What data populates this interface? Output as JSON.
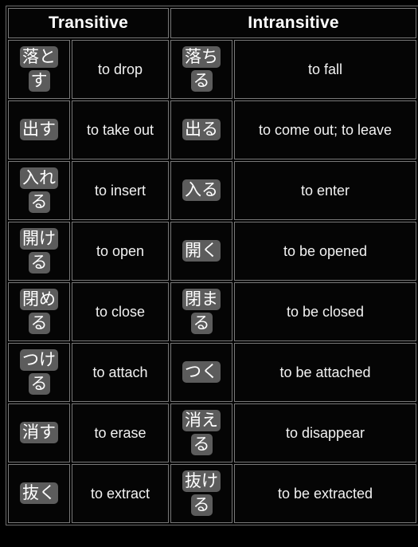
{
  "table": {
    "headers": [
      {
        "label": "Transitive",
        "span": 2
      },
      {
        "label": "Intransitive",
        "span": 2
      }
    ],
    "rows": [
      {
        "transitive_jp": "落とす",
        "transitive_en": "to drop",
        "intransitive_jp": "落ちる",
        "intransitive_en": "to fall"
      },
      {
        "transitive_jp": "出す",
        "transitive_en": "to take out",
        "intransitive_jp": "出る",
        "intransitive_en": "to come out; to leave"
      },
      {
        "transitive_jp": "入れる",
        "transitive_en": "to insert",
        "intransitive_jp": "入る",
        "intransitive_en": "to enter"
      },
      {
        "transitive_jp": "開ける",
        "transitive_en": "to open",
        "intransitive_jp": "開く",
        "intransitive_en": "to be opened"
      },
      {
        "transitive_jp": "閉める",
        "transitive_en": "to close",
        "intransitive_jp": "閉まる",
        "intransitive_en": "to be closed"
      },
      {
        "transitive_jp": "つける",
        "transitive_en": "to attach",
        "intransitive_jp": "つく",
        "intransitive_en": "to be attached"
      },
      {
        "transitive_jp": "消す",
        "transitive_en": "to erase",
        "intransitive_jp": "消える",
        "intransitive_en": "to disappear"
      },
      {
        "transitive_jp": "抜く",
        "transitive_en": "to extract",
        "intransitive_jp": "抜ける",
        "intransitive_en": "to be extracted"
      }
    ]
  },
  "colors": {
    "background": "#000000",
    "text": "#ffffff",
    "highlight": "#5c5c5c",
    "border": "#7a7a7a"
  }
}
